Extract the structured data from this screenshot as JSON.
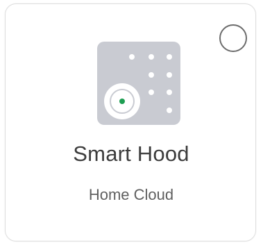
{
  "card": {
    "title": "Smart Hood",
    "subtitle": "Home Cloud",
    "selected": false
  },
  "icons": {
    "device": "smart-hood-icon",
    "select": "radio-unchecked-icon"
  },
  "colors": {
    "icon_bg": "#c9cbd2",
    "icon_dot": "#ffffff",
    "status_dot": "#1e9e52",
    "title_text": "#3c3c3c",
    "subtitle_text": "#5f5f5f",
    "card_border": "#dedede"
  }
}
